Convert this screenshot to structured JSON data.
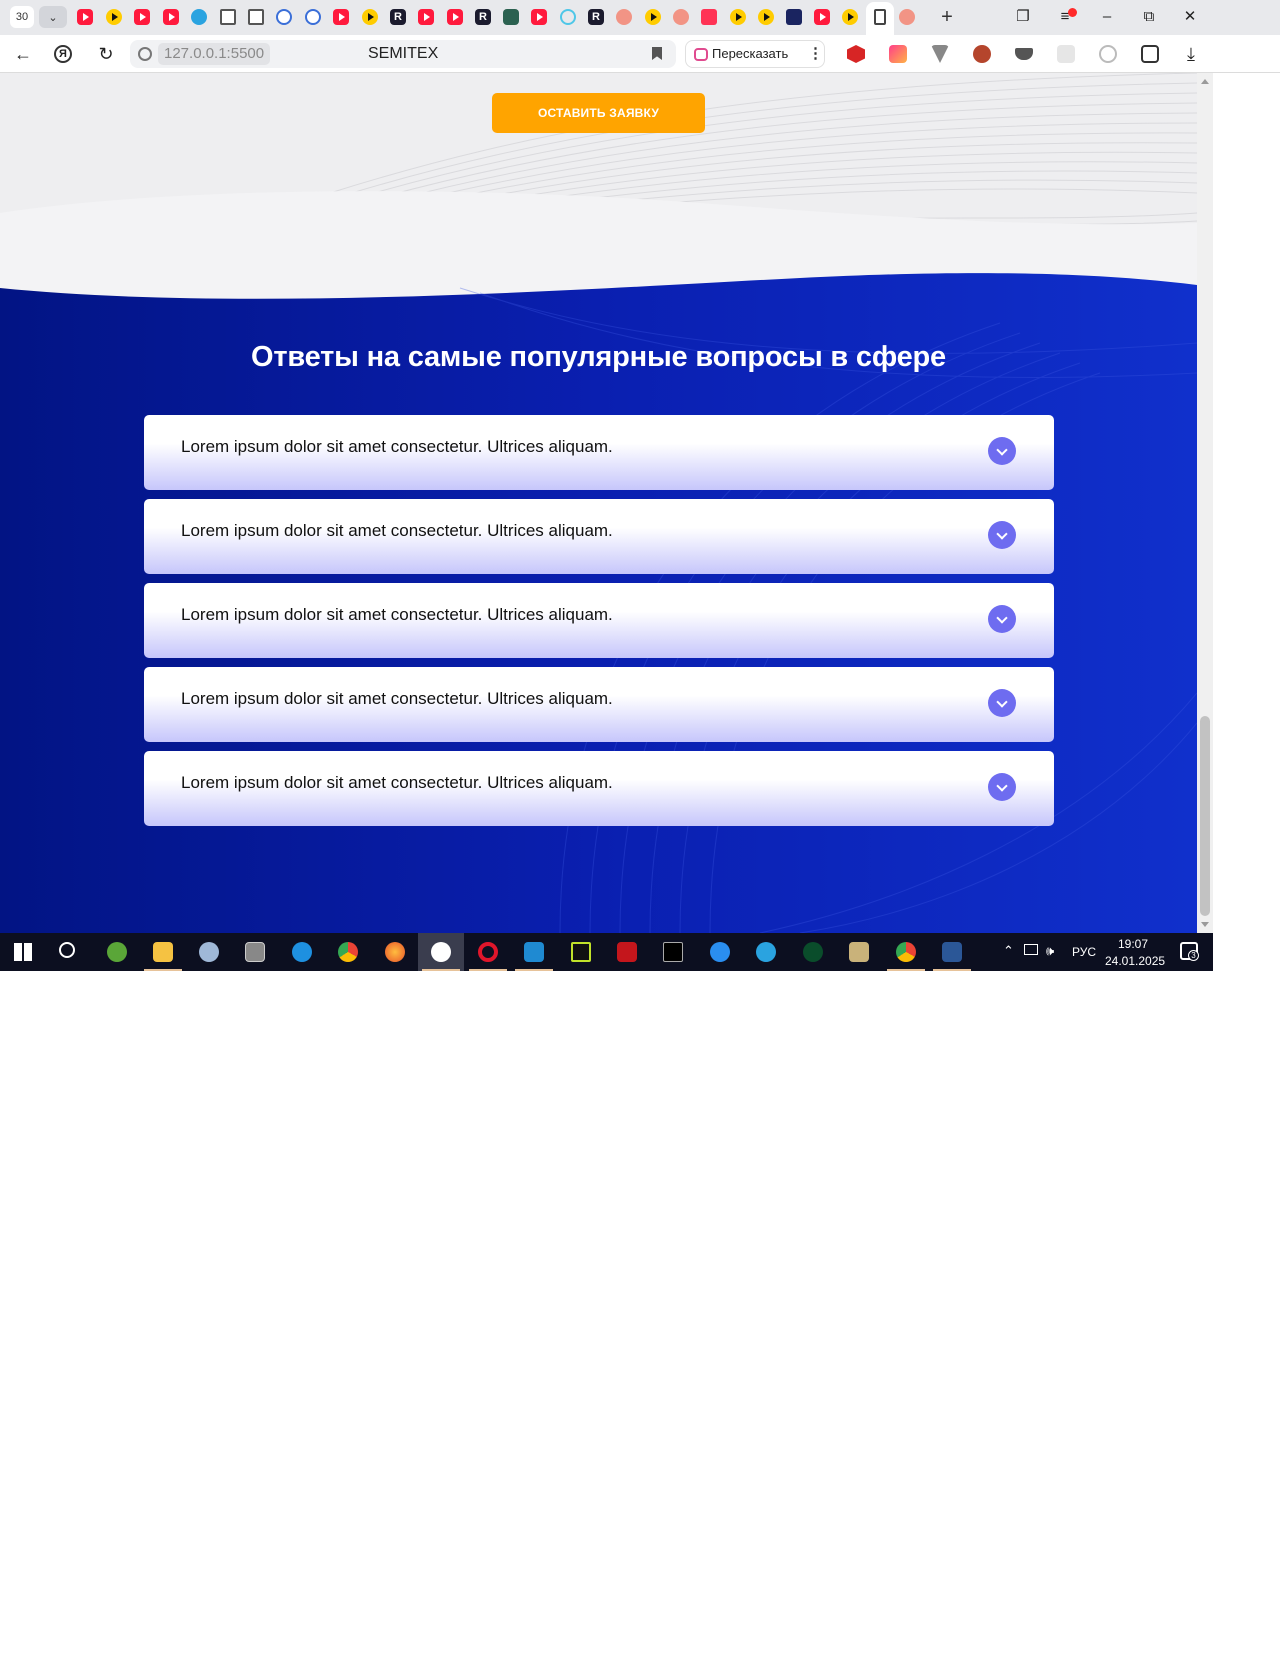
{
  "browser": {
    "tab_count": "30",
    "page_title": "SEMITEX",
    "url": "127.0.0.1:5500",
    "retell_label": "Пересказать"
  },
  "page": {
    "cta_label": "ОСТАВИТЬ ЗАЯВКУ",
    "faq_title": "Ответы на самые популярные вопросы в сфере",
    "faq": [
      {
        "question": "Lorem ipsum dolor sit amet consectetur. Ultrices aliquam."
      },
      {
        "question": "Lorem ipsum dolor sit amet consectetur. Ultrices aliquam."
      },
      {
        "question": "Lorem ipsum dolor sit amet consectetur. Ultrices aliquam."
      },
      {
        "question": "Lorem ipsum dolor sit amet consectetur. Ultrices aliquam."
      },
      {
        "question": "Lorem ipsum dolor sit amet consectetur. Ultrices aliquam."
      }
    ]
  },
  "taskbar": {
    "language": "РУС",
    "time": "19:07",
    "date": "24.01.2025",
    "notification_count": "3"
  },
  "colors": {
    "accent_orange": "#ffa400",
    "faq_blue": "#0a1fb0",
    "chevron_purple": "#6e6cf0"
  }
}
